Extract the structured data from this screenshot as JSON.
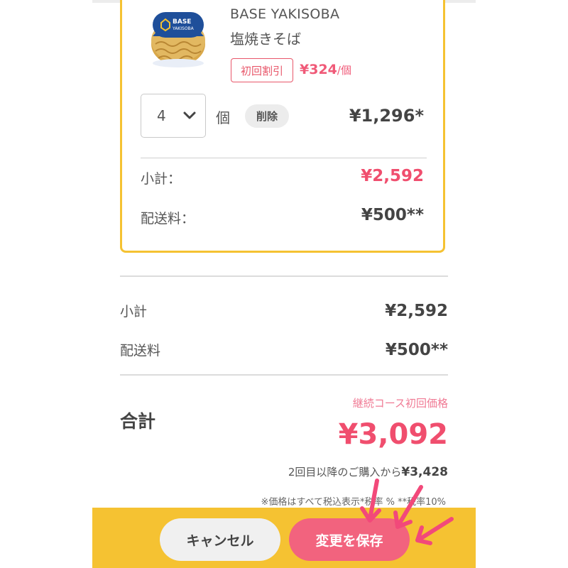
{
  "product": {
    "name": "BASE YAKISOBA",
    "variant": "塩焼きそば",
    "image_icon": "yakisoba-cup-image",
    "discount_badge": "初回割引",
    "unit_price": "¥324",
    "unit_suffix": "/個"
  },
  "quantity": {
    "value": "4",
    "unit": "個",
    "delete_label": "削除",
    "line_total": "¥1,296*"
  },
  "card_summary": {
    "subtotal_label": "小計：",
    "subtotal_value": "¥2,592",
    "shipping_label": "配送料：",
    "shipping_value": "¥500**"
  },
  "summary": {
    "subtotal_label": "小計",
    "subtotal_value": "¥2,592",
    "shipping_label": "配送料",
    "shipping_value": "¥500**"
  },
  "total": {
    "label": "合計",
    "course_note": "継続コース初回価格",
    "value": "¥3,092",
    "second_prefix": "2回目以降のご購入から",
    "second_value": "¥3,428",
    "tax_note": "※価格はすべて税込表示*税率 %  **税率10%"
  },
  "footer": {
    "cancel_label": "キャンセル",
    "save_label": "変更を保存"
  },
  "colors": {
    "accent_yellow": "#f5c232",
    "price_pink": "#f04e6e",
    "save_button": "#f2637e",
    "arrow_pink": "#f2497a"
  }
}
